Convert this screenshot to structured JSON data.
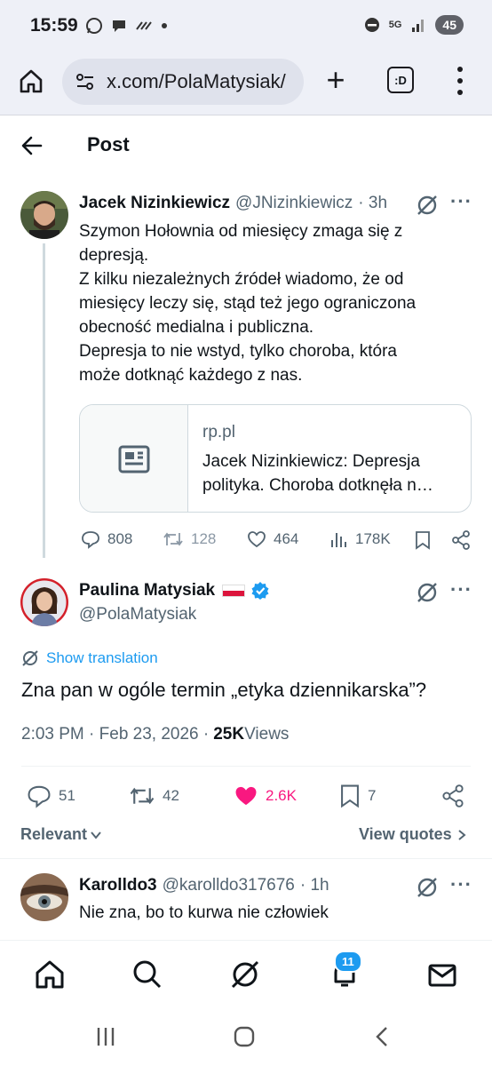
{
  "status": {
    "time": "15:59",
    "network": "5G",
    "battery": "45"
  },
  "browser": {
    "url": "x.com/PolaMatysiak/",
    "tab_label": ":D"
  },
  "header": {
    "title": "Post"
  },
  "quoted_post": {
    "author_name": "Jacek Nizinkiewicz",
    "author_handle": "@JNizinkiewicz",
    "time": "· 3h",
    "lines": [
      "Szymon Hołownia od miesięcy zmaga się z",
      "depresją.",
      "Z kilku niezależnych źródeł wiadomo, że od",
      "miesięcy leczy się, stąd też jego ograniczona",
      "obecność medialna i publiczna.",
      "Depresja to nie wstyd, tylko choroba, która",
      "może dotknąć każdego z nas."
    ],
    "link": {
      "domain": "rp.pl",
      "title": "Jacek Nizinkiewicz: Depresja polityka. Choroba dotknęła n…"
    },
    "stats": {
      "replies": "808",
      "reposts": "128",
      "likes": "464",
      "views": "178K"
    }
  },
  "main_post": {
    "author_name": "Paulina Matysiak",
    "author_handle": "@PolaMatysiak",
    "show_translation": "Show translation",
    "text": "Zna pan w ogóle termin „etyka dziennikarska”?",
    "timestamp": "2:03 PM · Feb 23, 2026 · ",
    "views_count": "25K",
    "views_label": " Views",
    "stats": {
      "replies": "51",
      "reposts": "42",
      "likes": "2.6K",
      "bookmarks": "7"
    },
    "sort_label": "Relevant",
    "quotes_label": "View quotes"
  },
  "reply": {
    "author_name": "Karolldo3",
    "author_handle": "@karolldo317676",
    "time": "· 1h",
    "text": "Nie zna, bo to kurwa nie człowiek"
  },
  "bottom_nav": {
    "notifications_badge": "11"
  },
  "colors": {
    "accent": "#1d9bf0",
    "like": "#f91880",
    "muted": "#536471"
  }
}
